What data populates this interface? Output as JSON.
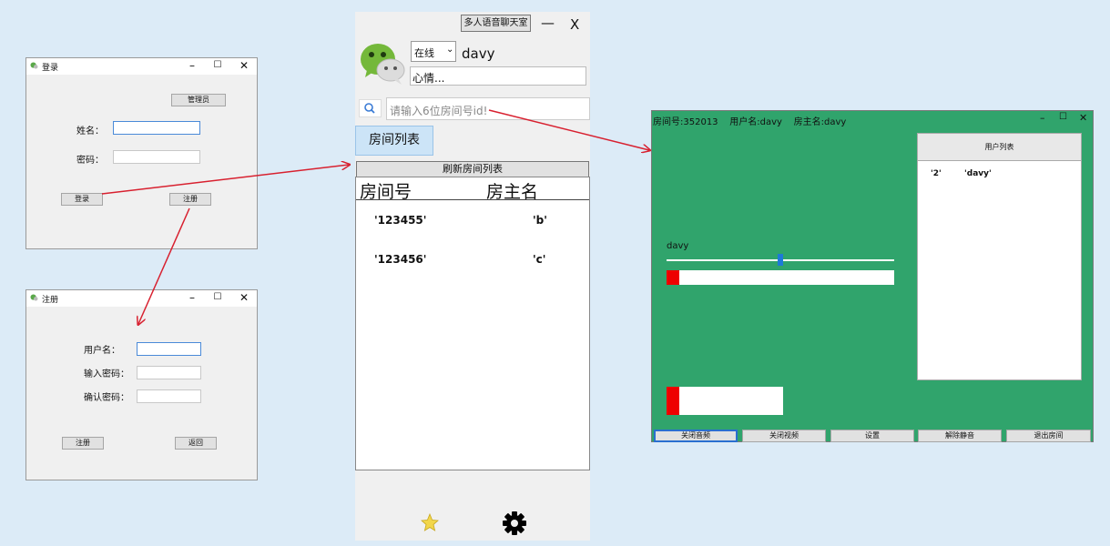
{
  "login_window": {
    "title": "登录",
    "admin_button": "管理员",
    "name_label": "姓名：",
    "password_label": "密码：",
    "login_button": "登录",
    "register_button": "注册"
  },
  "register_window": {
    "title": "注册",
    "username_label": "用户名：",
    "password_label": "输入密码：",
    "confirm_label": "确认密码：",
    "register_button": "注册",
    "back_button": "返回"
  },
  "main_panel": {
    "voice_chat_button": "多人语音聊天室",
    "minimize": "—",
    "close": "X",
    "status_value": "在线",
    "username": "davy",
    "mood": "心情...",
    "search_placeholder": "请输入6位房间号id!",
    "room_list_tab": "房间列表",
    "refresh_button": "刷新房间列表",
    "columns": [
      "房间号",
      "房主名"
    ],
    "rooms": [
      {
        "id": "'123455'",
        "owner": "'b'"
      },
      {
        "id": "'123456'",
        "owner": "'c'"
      }
    ]
  },
  "room_window": {
    "title": "房间号:352013    用户名:davy    房主名:davy",
    "user_list_header": "用户列表",
    "users": [
      {
        "id": "'2'",
        "name": "'davy'"
      }
    ],
    "speaker_name": "davy",
    "slider_level": 0.5,
    "buttons": [
      "关闭音频",
      "关闭视频",
      "设置",
      "解除静音",
      "退出房间"
    ]
  },
  "colors": {
    "room_background": "#30a46c",
    "arrow": "#d8202f",
    "level_red": "#ee0000",
    "tab_blue": "#cce4f7"
  }
}
